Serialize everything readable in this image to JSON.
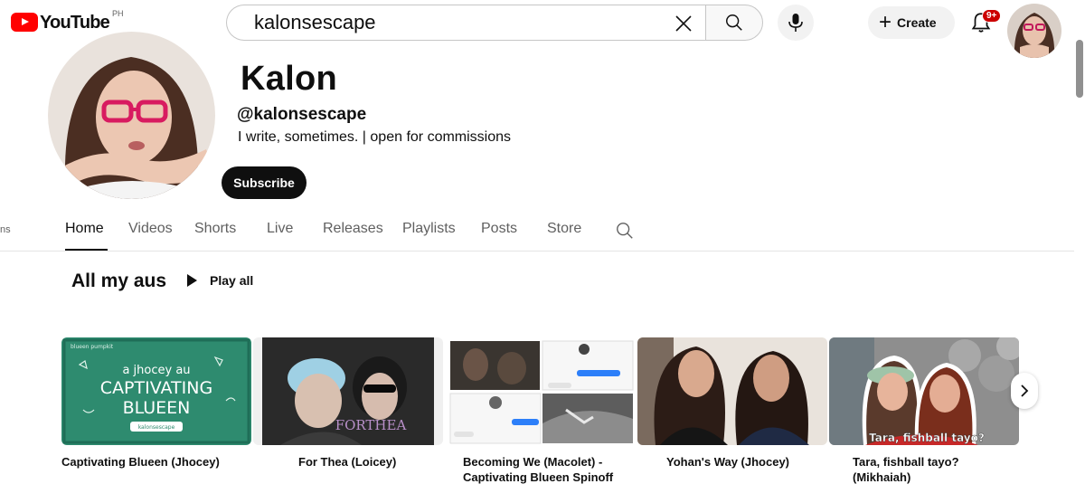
{
  "header": {
    "logo_text": "YouTube",
    "country_code": "PH",
    "search": {
      "value": "kalonsescape"
    },
    "create_label": "Create",
    "notification_count": "9+"
  },
  "channel": {
    "name": "Kalon",
    "handle": "@kalonsescape",
    "description": "I write, sometimes. | open for commissions",
    "subscribe_label": "Subscribe",
    "left_edge_fragment": "ns"
  },
  "tabs": [
    {
      "label": "Home",
      "active": true
    },
    {
      "label": "Videos"
    },
    {
      "label": "Shorts"
    },
    {
      "label": "Live"
    },
    {
      "label": "Releases"
    },
    {
      "label": "Playlists"
    },
    {
      "label": "Posts"
    },
    {
      "label": "Store"
    }
  ],
  "shelf": {
    "title": "All my aus",
    "play_all_label": "Play all",
    "items": [
      {
        "title": "Captivating Blueen (Jhocey)",
        "thumb_text": {
          "small": "blueen pumpkit",
          "line1": "a jhocey au",
          "line2": "CAPTIVATING",
          "line3": "BLUEEN",
          "tag": "kalonsescape"
        }
      },
      {
        "title": "For Thea (Loicey)",
        "thumb_text": {
          "overlay": "FORTHEA"
        }
      },
      {
        "title": "Becoming We (Macolet) - Captivating Blueen Spinoff"
      },
      {
        "title": "Yohan's Way (Jhocey)"
      },
      {
        "title": "Tara, fishball tayo? (Mikhaiah)",
        "thumb_text": {
          "overlay": "Tara, fishball tayo?"
        }
      }
    ]
  },
  "colors": {
    "brand_red": "#ff0000",
    "subscribe_bg": "#0f0f0f",
    "chalkboard_green": "#2e8b6f",
    "badge_red": "#cc0000"
  },
  "icons": {
    "search": "search-icon",
    "clear": "close-icon",
    "mic": "microphone-icon",
    "create": "plus-icon",
    "bell": "bell-icon",
    "play": "play-icon",
    "next": "chevron-right-icon"
  }
}
